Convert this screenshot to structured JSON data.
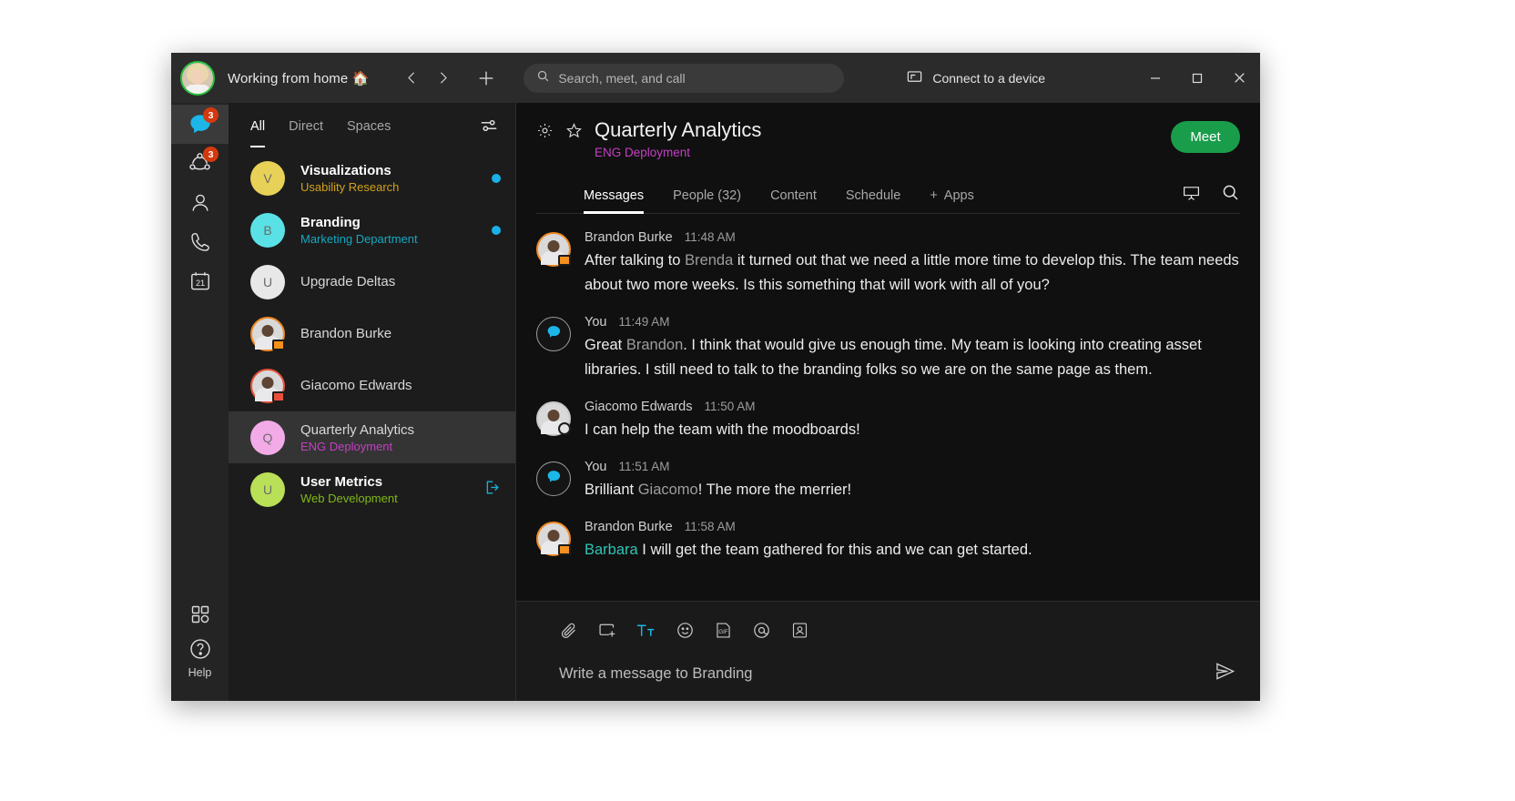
{
  "titlebar": {
    "status": "Working from home 🏠",
    "back_icon": "chevron-left-icon",
    "forward_icon": "chevron-right-icon",
    "plus_icon": "plus-icon",
    "search_placeholder": "Search, meet, and call",
    "connect_label": "Connect to a device",
    "minimize_label": "–",
    "maximize_label": "□",
    "close_label": "✕"
  },
  "rail": {
    "items": [
      {
        "name": "messaging",
        "badge": "3",
        "active": true
      },
      {
        "name": "teams",
        "badge": "3",
        "active": false
      },
      {
        "name": "contacts",
        "badge": "",
        "active": false
      },
      {
        "name": "calling",
        "badge": "",
        "active": false
      },
      {
        "name": "meetings",
        "badge": "",
        "active": false,
        "day": "21"
      }
    ],
    "apps_label": "apps-grid-icon",
    "help_label": "Help"
  },
  "conversation_list": {
    "tabs": [
      {
        "label": "All",
        "active": true
      },
      {
        "label": "Direct",
        "active": false
      },
      {
        "label": "Spaces",
        "active": false
      }
    ],
    "filter_icon": "filter-icon",
    "rows": [
      {
        "initial": "V",
        "title": "Visualizations",
        "subtitle": "Usability Research",
        "avatar_color": "#e8d157",
        "sub_color": "#d2a21c",
        "unread": true,
        "selected": false,
        "type": "space",
        "dot": true
      },
      {
        "initial": "B",
        "title": "Branding",
        "subtitle": "Marketing Department",
        "avatar_color": "#5ae1e6",
        "sub_color": "#15a8c0",
        "unread": true,
        "selected": false,
        "type": "space",
        "dot": true
      },
      {
        "initial": "U",
        "title": "Upgrade Deltas",
        "subtitle": "",
        "avatar_color": "#e8e8e8",
        "sub_color": "",
        "unread": false,
        "selected": false,
        "type": "space",
        "dot": false
      },
      {
        "initial": "",
        "title": "Brandon Burke",
        "subtitle": "",
        "avatar_color": "#d9d9d9",
        "sub_color": "",
        "unread": false,
        "selected": false,
        "type": "person",
        "ring": "#f08a24",
        "presence": "#f4901e",
        "dot": false
      },
      {
        "initial": "",
        "title": "Giacomo Edwards",
        "subtitle": "",
        "avatar_color": "#d9d9d9",
        "sub_color": "",
        "unread": false,
        "selected": false,
        "type": "person",
        "ring": "#e8503a",
        "presence": "#e8503a",
        "dot": false
      },
      {
        "initial": "Q",
        "title": "Quarterly Analytics",
        "subtitle": "ENG Deployment",
        "avatar_color": "#f3abe8",
        "sub_color": "#c43fc4",
        "unread": false,
        "selected": true,
        "type": "space",
        "dot": false
      },
      {
        "initial": "U",
        "title": "User Metrics",
        "subtitle": "Web Development",
        "avatar_color": "#bae057",
        "sub_color": "#7fb818",
        "unread": true,
        "selected": false,
        "type": "space",
        "dot": false,
        "leave_icon": "leave-space-icon"
      }
    ]
  },
  "space": {
    "settings_icon": "gear-icon",
    "favorite_icon": "star-icon",
    "title": "Quarterly Analytics",
    "subtitle": "ENG Deployment",
    "subtitle_color": "#c43fc4",
    "meet_button": "Meet",
    "meet_color": "#1a9d4b",
    "tabs": [
      {
        "label": "Messages",
        "active": true
      },
      {
        "label": "People (32)",
        "active": false
      },
      {
        "label": "Content",
        "active": false
      },
      {
        "label": "Schedule",
        "active": false
      },
      {
        "label": "Apps",
        "active": false,
        "prefix": "+"
      }
    ],
    "whiteboard_icon": "whiteboard-icon",
    "search_icon": "search-icon"
  },
  "messages": [
    {
      "author": "Brandon Burke",
      "time": "11:48 AM",
      "avatar": "photo",
      "ring": "#f08a24",
      "presence": "#f4901e",
      "presence_type": "video",
      "parts": [
        {
          "t": "After talking to ",
          "style": "normal"
        },
        {
          "t": "Brenda",
          "style": "mention-gray"
        },
        {
          "t": " it turned out that we need a little more time to develop this. The team needs about two more weeks. Is this something that will work with all of you?",
          "style": "normal"
        }
      ]
    },
    {
      "author": "You",
      "time": "11:49 AM",
      "avatar": "bubble",
      "parts": [
        {
          "t": "Great ",
          "style": "normal"
        },
        {
          "t": "Brandon",
          "style": "mention-gray"
        },
        {
          "t": ". I think that would give us enough time. My team is looking into creating asset libraries. I still need to talk to the branding folks so we are on the same page as them.",
          "style": "normal"
        }
      ]
    },
    {
      "author": "Giacomo Edwards",
      "time": "11:50 AM",
      "avatar": "photo",
      "ring": "#c9c9c9",
      "presence": "#d8d8d8",
      "presence_type": "clock",
      "parts": [
        {
          "t": "I can help the team with the moodboards!",
          "style": "normal"
        }
      ]
    },
    {
      "author": "You",
      "time": "11:51 AM",
      "avatar": "bubble",
      "parts": [
        {
          "t": "Brilliant ",
          "style": "normal"
        },
        {
          "t": "Giacomo",
          "style": "mention-gray"
        },
        {
          "t": "! The more the merrier!",
          "style": "normal"
        }
      ]
    },
    {
      "author": "Brandon Burke",
      "time": "11:58 AM",
      "avatar": "photo",
      "ring": "#f08a24",
      "presence": "#f4901e",
      "presence_type": "video",
      "cut": true,
      "parts": [
        {
          "t": "Barbara",
          "style": "mention-teal"
        },
        {
          "t": " I will get the team gathered for this and we can get started.",
          "style": "normal"
        }
      ]
    }
  ],
  "composer": {
    "tools": [
      {
        "name": "attach-icon",
        "active": false
      },
      {
        "name": "screen-share-icon",
        "active": false
      },
      {
        "name": "text-format-icon",
        "active": true,
        "label": "Tt"
      },
      {
        "name": "emoji-icon",
        "active": false
      },
      {
        "name": "gif-icon",
        "active": false,
        "label": "GIF"
      },
      {
        "name": "mention-icon",
        "active": false,
        "label": "@"
      },
      {
        "name": "contact-card-icon",
        "active": false
      }
    ],
    "placeholder": "Write a message to Branding",
    "send_icon": "send-icon"
  }
}
